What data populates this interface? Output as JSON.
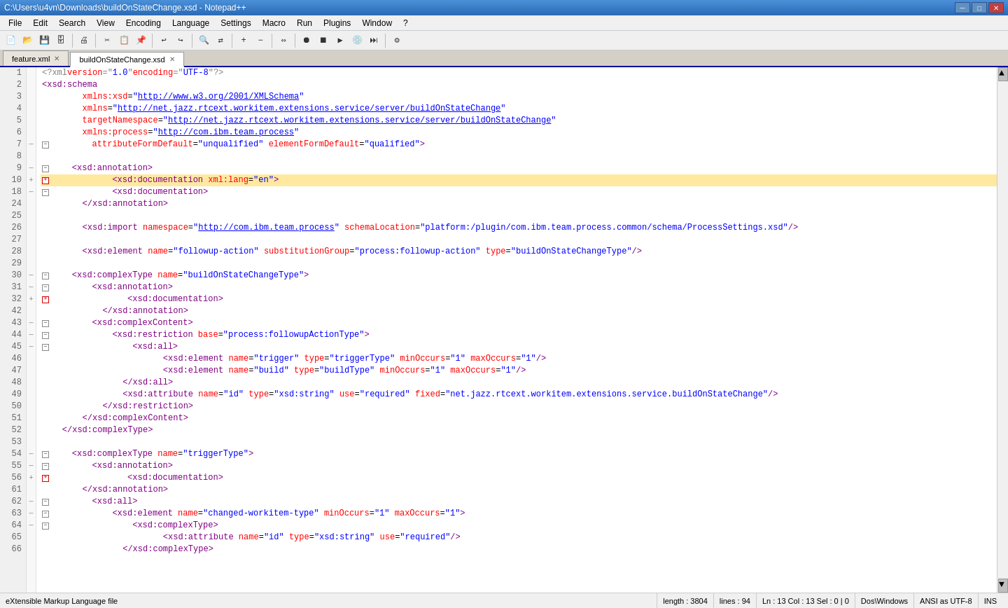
{
  "titlebar": {
    "text": "C:\\Users\\u4vn\\Downloads\\buildOnStateChange.xsd - Notepad++",
    "min_label": "─",
    "max_label": "□",
    "close_label": "✕"
  },
  "menubar": {
    "items": [
      "File",
      "Edit",
      "Search",
      "View",
      "Encoding",
      "Language",
      "Settings",
      "Macro",
      "Run",
      "Plugins",
      "Window",
      "?"
    ]
  },
  "tabs": [
    {
      "id": "feature",
      "label": "feature.xml",
      "active": false
    },
    {
      "id": "build",
      "label": "buildOnStateChange.xsd",
      "active": true
    }
  ],
  "statusbar": {
    "filetype": "eXtensible Markup Language file",
    "length": "length : 3804",
    "lines": "lines : 94",
    "position": "Ln : 13   Col : 13   Sel : 0 | 0",
    "eol": "Dos\\Windows",
    "encoding": "ANSI as UTF-8",
    "mode": "INS"
  },
  "lines": [
    {
      "num": 1,
      "fold": "",
      "content": "xml_pi",
      "highlighted": false
    },
    {
      "num": 2,
      "fold": "",
      "content": "xsd_schema_open",
      "highlighted": false
    },
    {
      "num": 3,
      "fold": "",
      "content": "xmlns_xsd",
      "highlighted": false
    },
    {
      "num": 4,
      "fold": "",
      "content": "xmlns",
      "highlighted": false
    },
    {
      "num": 5,
      "fold": "",
      "content": "targetNamespace",
      "highlighted": false
    },
    {
      "num": 6,
      "fold": "",
      "content": "xmlns_process",
      "highlighted": false
    },
    {
      "num": 7,
      "fold": "minus",
      "content": "attributeFormDefault",
      "highlighted": false
    },
    {
      "num": 8,
      "fold": "",
      "content": "blank",
      "highlighted": false
    },
    {
      "num": 9,
      "fold": "minus",
      "content": "xsd_annotation_open",
      "highlighted": false
    },
    {
      "num": 10,
      "fold": "plus",
      "content": "xsd_documentation_en",
      "highlighted": true
    },
    {
      "num": 18,
      "fold": "minus",
      "content": "xsd_documentation2",
      "highlighted": false
    },
    {
      "num": 24,
      "fold": "",
      "content": "xsd_annotation_close",
      "highlighted": false
    },
    {
      "num": 25,
      "fold": "",
      "content": "blank2",
      "highlighted": false
    },
    {
      "num": 26,
      "fold": "",
      "content": "xsd_import",
      "highlighted": false
    },
    {
      "num": 27,
      "fold": "",
      "content": "blank3",
      "highlighted": false
    },
    {
      "num": 28,
      "fold": "",
      "content": "xsd_element_followup",
      "highlighted": false
    },
    {
      "num": 29,
      "fold": "",
      "content": "blank4",
      "highlighted": false
    },
    {
      "num": 30,
      "fold": "minus",
      "content": "xsd_complexType_build",
      "highlighted": false
    },
    {
      "num": 31,
      "fold": "minus",
      "content": "xsd_annotation_31",
      "highlighted": false
    },
    {
      "num": 32,
      "fold": "plus",
      "content": "xsd_documentation_32",
      "highlighted": false
    },
    {
      "num": 42,
      "fold": "",
      "content": "xsd_annotation_close_42",
      "highlighted": false
    },
    {
      "num": 43,
      "fold": "minus",
      "content": "xsd_complexContent_open",
      "highlighted": false
    },
    {
      "num": 44,
      "fold": "minus",
      "content": "xsd_restriction_open",
      "highlighted": false
    },
    {
      "num": 45,
      "fold": "minus",
      "content": "xsd_all_open",
      "highlighted": false
    },
    {
      "num": 46,
      "fold": "",
      "content": "xsd_element_trigger",
      "highlighted": false
    },
    {
      "num": 47,
      "fold": "",
      "content": "xsd_element_build",
      "highlighted": false
    },
    {
      "num": 48,
      "fold": "",
      "content": "xsd_all_close",
      "highlighted": false
    },
    {
      "num": 49,
      "fold": "",
      "content": "xsd_attribute_id",
      "highlighted": false
    },
    {
      "num": 50,
      "fold": "",
      "content": "xsd_restriction_close",
      "highlighted": false
    },
    {
      "num": 51,
      "fold": "",
      "content": "xsd_complexContent_close",
      "highlighted": false
    },
    {
      "num": 52,
      "fold": "",
      "content": "xsd_complexType_close",
      "highlighted": false
    },
    {
      "num": 53,
      "fold": "",
      "content": "blank5",
      "highlighted": false
    },
    {
      "num": 54,
      "fold": "minus",
      "content": "xsd_complexType_trigger",
      "highlighted": false
    },
    {
      "num": 55,
      "fold": "minus",
      "content": "xsd_annotation_55",
      "highlighted": false
    },
    {
      "num": 56,
      "fold": "plus",
      "content": "xsd_documentation_56",
      "highlighted": false
    },
    {
      "num": 61,
      "fold": "",
      "content": "xsd_annotation_close_61",
      "highlighted": false
    },
    {
      "num": 62,
      "fold": "minus",
      "content": "xsd_all_62",
      "highlighted": false
    },
    {
      "num": 63,
      "fold": "minus",
      "content": "xsd_element_workitem",
      "highlighted": false
    },
    {
      "num": 64,
      "fold": "minus",
      "content": "xsd_complexType_64",
      "highlighted": false
    },
    {
      "num": 65,
      "fold": "",
      "content": "xsd_attribute_id_65",
      "highlighted": false
    },
    {
      "num": 66,
      "fold": "",
      "content": "xsd_complexType_close_66",
      "highlighted": false
    }
  ]
}
